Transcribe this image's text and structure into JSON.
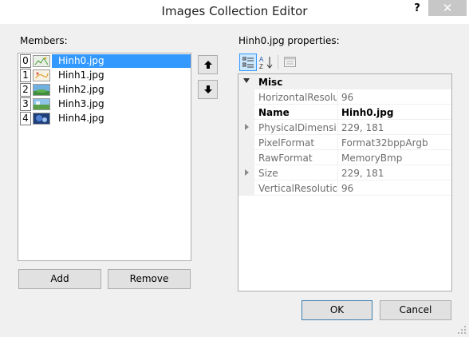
{
  "window": {
    "title": "Images Collection Editor",
    "help_label": "?",
    "close_label": "✕"
  },
  "members": {
    "label": "Members:",
    "items": [
      {
        "index": "0",
        "name": "Hinh0.jpg",
        "selected": true
      },
      {
        "index": "1",
        "name": "Hinh1.jpg",
        "selected": false
      },
      {
        "index": "2",
        "name": "Hinh2.jpg",
        "selected": false
      },
      {
        "index": "3",
        "name": "Hinh3.jpg",
        "selected": false
      },
      {
        "index": "4",
        "name": "Hinh4.jpg",
        "selected": false
      }
    ],
    "add_label": "Add",
    "remove_label": "Remove"
  },
  "properties": {
    "label": "Hinh0.jpg properties:",
    "category": "Misc",
    "rows": [
      {
        "name": "HorizontalResolution",
        "value": "96",
        "bold": false,
        "expandable": false
      },
      {
        "name": "Name",
        "value": "Hinh0.jpg",
        "bold": true,
        "expandable": false
      },
      {
        "name": "PhysicalDimension",
        "value": "229, 181",
        "bold": false,
        "expandable": true
      },
      {
        "name": "PixelFormat",
        "value": "Format32bppArgb",
        "bold": false,
        "expandable": false
      },
      {
        "name": "RawFormat",
        "value": "MemoryBmp",
        "bold": false,
        "expandable": false
      },
      {
        "name": "Size",
        "value": "229, 181",
        "bold": false,
        "expandable": true
      },
      {
        "name": "VerticalResolution",
        "value": "96",
        "bold": false,
        "expandable": false
      }
    ]
  },
  "footer": {
    "ok_label": "OK",
    "cancel_label": "Cancel"
  },
  "colors": {
    "selection": "#3399ff",
    "dialog_bg": "#f0f0f0",
    "default_button_border": "#3c7fb1"
  },
  "icons": {
    "move_up": "arrow-up-icon",
    "move_down": "arrow-down-icon",
    "categorized": "categorized-icon",
    "alphabetical": "alphabetical-icon",
    "property_pages": "property-pages-icon"
  }
}
